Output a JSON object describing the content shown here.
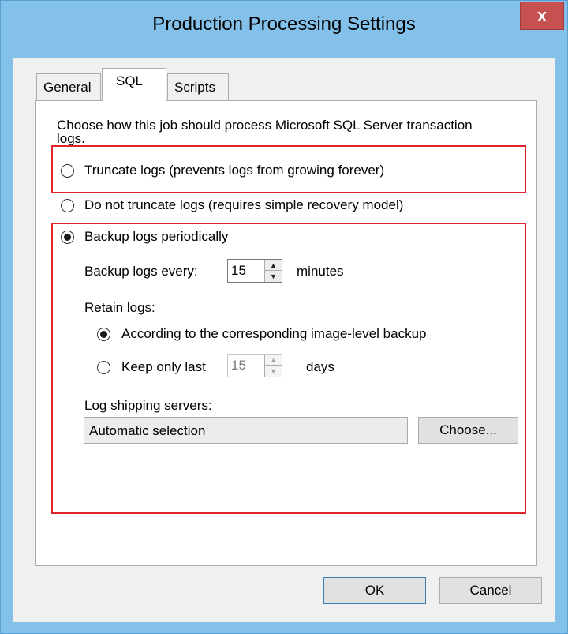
{
  "window": {
    "title": "Production Processing Settings",
    "close_label": "x"
  },
  "tabs": [
    {
      "label": "General",
      "active": false
    },
    {
      "label": "SQL",
      "active": true
    },
    {
      "label": "Scripts",
      "active": false
    }
  ],
  "sql": {
    "intro": "Choose how this job should process Microsoft SQL Server transaction logs.",
    "options": [
      {
        "label": "Truncate logs (prevents logs from growing forever)",
        "checked": false
      },
      {
        "label": "Do not truncate logs (requires simple recovery model)",
        "checked": false
      },
      {
        "label": "Backup logs periodically",
        "checked": true
      }
    ],
    "backup_every_label": "Backup logs every:",
    "backup_every_value": "15",
    "backup_every_unit": "minutes",
    "retain_label": "Retain logs:",
    "retain_options": [
      {
        "label": "According to the corresponding image-level backup",
        "checked": true
      },
      {
        "label": "Keep only last",
        "checked": false
      }
    ],
    "keep_last_value": "15",
    "keep_last_unit": "days",
    "shipping_label": "Log shipping servers:",
    "shipping_value": "Automatic selection",
    "choose_label": "Choose..."
  },
  "footer": {
    "ok_label": "OK",
    "cancel_label": "Cancel"
  },
  "colors": {
    "highlight": "#e0242b",
    "titlebar": "#84c1ea",
    "close": "#c75050"
  }
}
